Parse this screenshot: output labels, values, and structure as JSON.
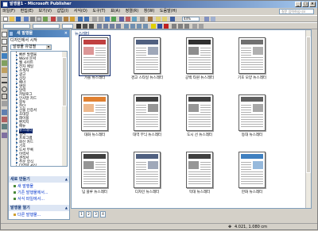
{
  "window": {
    "title": "발행물1 - Microsoft Publisher"
  },
  "menu": [
    "파일(F)",
    "편집(E)",
    "보기(V)",
    "삽입(I)",
    "서식(O)",
    "도구(T)",
    "표(A)",
    "정렬(R)",
    "창(W)",
    "도움말(H)"
  ],
  "help_search": {
    "placeholder": "질문 입력하십시오"
  },
  "toolbar": {
    "zoom": "44%"
  },
  "taskpane": {
    "header": "새 발행물",
    "subtitle": "디자인에서 시작",
    "combo": "발행물 유형별",
    "tree_items": [
      "빠른 발행물",
      "Word 문서",
      "웹 사이트",
      "전자 메일",
      "소책자",
      "광고",
      "상장",
      "배너",
      "명함",
      "달력",
      "카탈로그",
      "인사말 카드",
      "봉투",
      "전단",
      "선물 인증서",
      "초대장",
      "레이블",
      "편지지",
      "메뉴",
      "뉴스레터",
      "엽서",
      "프로그램",
      "회신 카드",
      "기호",
      "도서 부록",
      "이력서",
      "견적서",
      "주문 양식",
      "다양한 서식"
    ],
    "selected_index": 19,
    "section_new": "새로 만들기",
    "new_links": [
      "새 발행물",
      "기존 발행물에서...",
      "서식 파일에서..."
    ],
    "section_open": "발행물 열기",
    "open_links": [
      "다른 발행물..."
    ]
  },
  "main": {
    "title": "뉴스레터",
    "thumbnails": [
      {
        "label": "가을 뉴스레터",
        "accent": "#c04040"
      },
      {
        "label": "경고 스타일 뉴스레터",
        "accent": "#506080"
      },
      {
        "label": "공백 타원 뉴스레터",
        "accent": "#303030"
      },
      {
        "label": "기호 모양 뉴스레터",
        "accent": "#707070"
      },
      {
        "label": "대화 뉴스레터",
        "accent": "#e08030"
      },
      {
        "label": "대역 무늬 뉴스레터",
        "accent": "#404040"
      },
      {
        "label": "도시 선 뉴스레터",
        "accent": "#404040"
      },
      {
        "label": "등대 뉴스레터",
        "accent": "#606060"
      },
      {
        "label": "딥 블루 뉴스레터",
        "accent": "#404040"
      },
      {
        "label": "디자인 뉴스레터",
        "accent": "#506080"
      },
      {
        "label": "막대 뉴스레터",
        "accent": "#404040"
      },
      {
        "label": "만화 뉴스레터",
        "accent": "#4080c0"
      }
    ],
    "selected_index": 0
  },
  "page_nav": [
    "1",
    "2",
    "3",
    "4"
  ],
  "status": {
    "coords": "4.021, 1.080 cm"
  }
}
